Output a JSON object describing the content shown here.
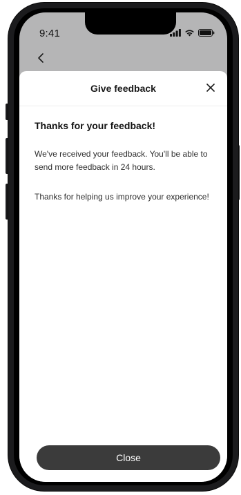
{
  "status_bar": {
    "time": "9:41",
    "icons": [
      "signal-icon",
      "wifi-icon",
      "battery-icon"
    ]
  },
  "nav": {
    "back_icon": "chevron-left-icon"
  },
  "sheet": {
    "title": "Give feedback",
    "close_icon": "close-icon",
    "heading": "Thanks for your feedback!",
    "paragraph_1": "We've received your feedback. You'll be able to send more feedback in 24 hours.",
    "paragraph_2": "Thanks for helping us improve your experience!",
    "close_button_label": "Close"
  },
  "colors": {
    "backdrop": "#b5b5b6",
    "sheet_background": "#ffffff",
    "button_background": "#3b3b3b",
    "button_text": "#ffffff",
    "text_primary": "#111111"
  }
}
